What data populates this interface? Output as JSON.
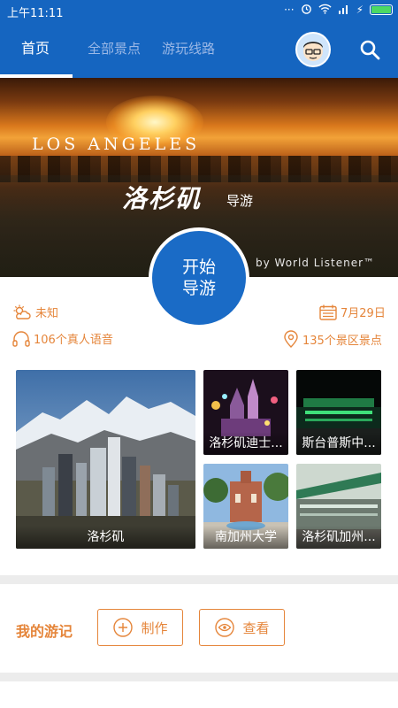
{
  "status_bar": {
    "time": "上午11:11"
  },
  "tabs": [
    {
      "label": "首页",
      "active": true
    },
    {
      "label": "全部景点",
      "active": false
    },
    {
      "label": "游玩线路",
      "active": false
    }
  ],
  "hero": {
    "city_en": "Los Angeles",
    "city_cn": "洛杉矶",
    "guide": "导游",
    "credit": "by World Listener™"
  },
  "start_button": {
    "line1": "开始",
    "line2": "导游"
  },
  "info": {
    "weather": "未知",
    "date": "7月29日",
    "audio_count": "106个真人语音",
    "spots_count": "135个景区景点"
  },
  "tiles": [
    {
      "label": "洛杉矶"
    },
    {
      "label": "洛杉矶迪士..."
    },
    {
      "label": "斯台普斯中..."
    },
    {
      "label": "南加州大学"
    },
    {
      "label": "洛杉矶加州..."
    }
  ],
  "journal": {
    "title": "我的游记",
    "create_label": "制作",
    "view_label": "查看"
  },
  "colors": {
    "primary": "#1565c0",
    "accent": "#e5853a"
  },
  "icons": [
    "signal-icon",
    "alarm-icon",
    "wifi-icon",
    "battery-icon",
    "avatar",
    "search-icon",
    "weather-icon",
    "calendar-icon",
    "headphones-icon",
    "location-pin-icon",
    "plus-icon",
    "eye-icon"
  ]
}
